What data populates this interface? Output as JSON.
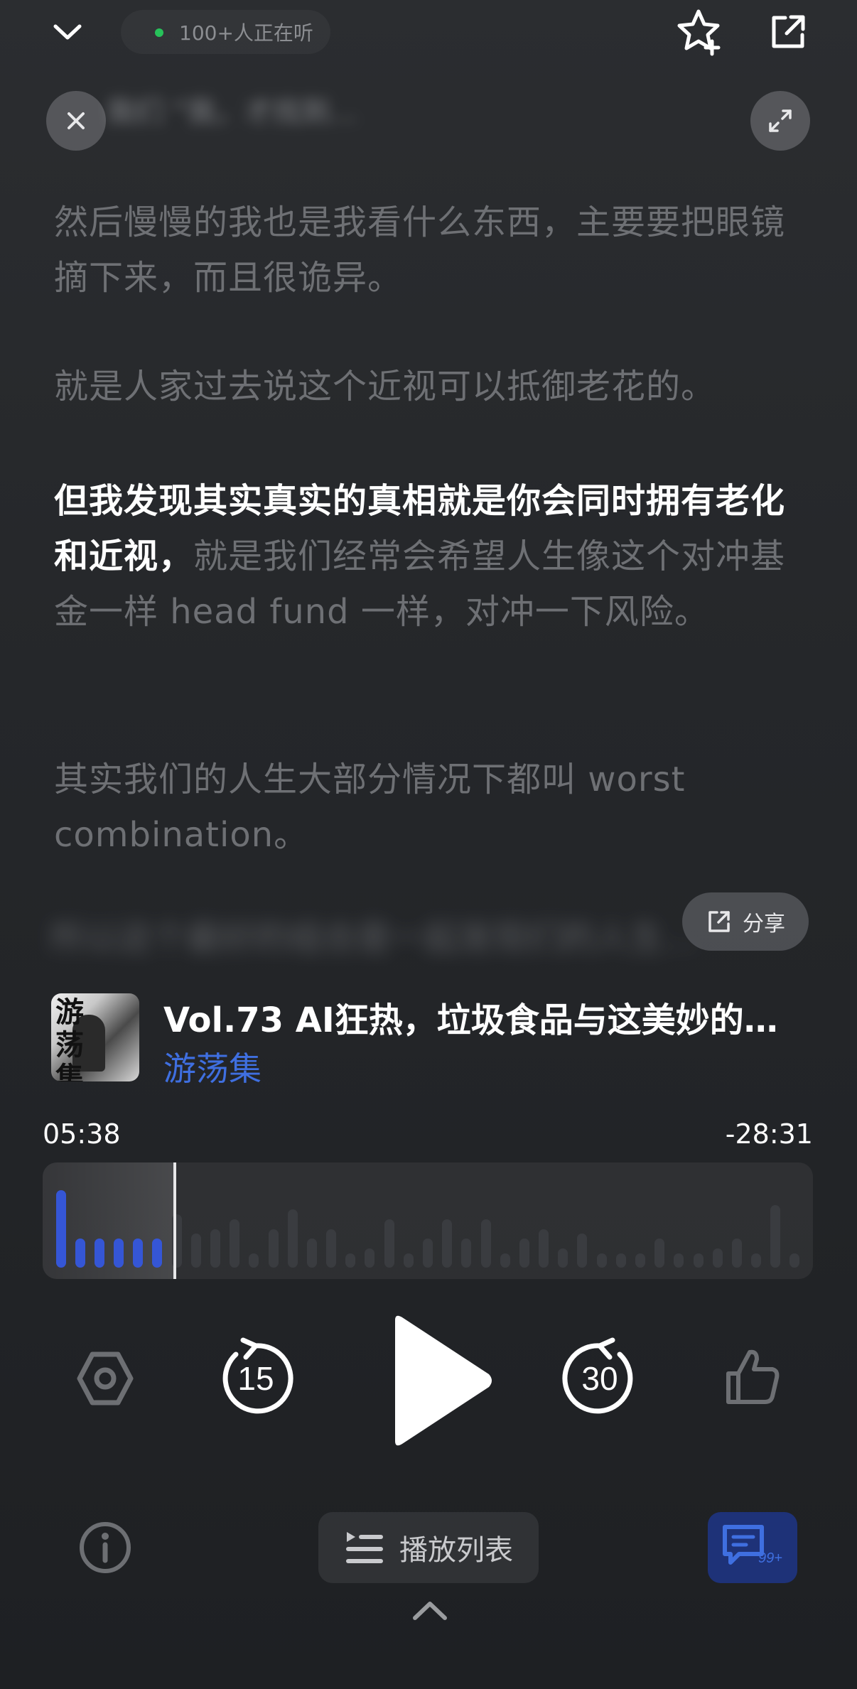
{
  "header": {
    "listeners": "100+人正在听"
  },
  "overlay": {
    "blurred_top_line": "我们 “我，才找到…"
  },
  "transcript": {
    "paragraphs": [
      {
        "parts": [
          {
            "text": "然后慢慢的我也是我看什么东西，主要要把眼镜摘下来，而且很诡异。",
            "active": false
          }
        ]
      },
      {
        "parts": [
          {
            "text": "就是人家过去说这个近视可以抵御老花的。",
            "active": false
          }
        ]
      },
      {
        "parts": [
          {
            "text": "但我发现其实真实的真相就是你会同时拥有老化和近视，",
            "active": true
          },
          {
            "text": "就是我们经常会希望人生像这个对冲基金一样 head fund 一样，对冲一下风险。",
            "active": false
          }
        ]
      },
      {
        "parts": [
          {
            "text": "其实我们的人生大部分情况下都叫 worst combination。",
            "active": false
          }
        ]
      }
    ],
    "blurred_bottom_line": "所以这个最好的组合是一起发现们的人生…",
    "share_label": "分享"
  },
  "episode": {
    "title": "Vol.73 AI狂热，垃圾食品与这美妙的…",
    "podcast": "游荡集",
    "cover_text": "游荡集"
  },
  "progress": {
    "elapsed": "05:38",
    "remaining": "-28:31",
    "played_fraction": 0.17,
    "bars": [
      0.8,
      0.3,
      0.3,
      0.3,
      0.3,
      0.3,
      0.55,
      0.35,
      0.4,
      0.5,
      0.15,
      0.4,
      0.6,
      0.3,
      0.4,
      0.15,
      0.2,
      0.5,
      0.15,
      0.3,
      0.5,
      0.3,
      0.5,
      0.15,
      0.3,
      0.4,
      0.2,
      0.35,
      0.15,
      0.15,
      0.15,
      0.3,
      0.15,
      0.15,
      0.2,
      0.3,
      0.15,
      0.65,
      0.15
    ]
  },
  "controls": {
    "rewind_seconds": "15",
    "forward_seconds": "30"
  },
  "bottom": {
    "playlist_label": "播放列表",
    "comment_badge": "99+"
  },
  "colors": {
    "accent": "#3f6fe0",
    "bar_played": "#3556d6",
    "bar_unplayed": "#3a3c40",
    "live_dot": "#27c25a"
  }
}
